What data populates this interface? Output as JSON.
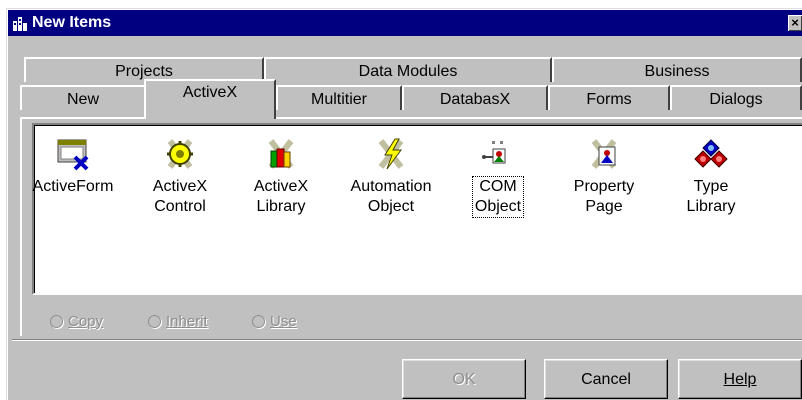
{
  "window": {
    "title": "New Items",
    "close_glyph": "×"
  },
  "tabs_row1": [
    "Projects",
    "Data Modules",
    "Business"
  ],
  "tabs_row2": [
    "New",
    "ActiveX",
    "Multitier",
    "DatabasX",
    "Forms",
    "Dialogs"
  ],
  "active_tab": "ActiveX",
  "items": [
    {
      "label": "ActiveForm",
      "icon": "activeform-icon"
    },
    {
      "label": "ActiveX\nControl",
      "icon": "activex-control-icon"
    },
    {
      "label": "ActiveX\nLibrary",
      "icon": "activex-library-icon"
    },
    {
      "label": "Automation\nObject",
      "icon": "automation-object-icon"
    },
    {
      "label": "COM\nObject",
      "icon": "com-object-icon",
      "focused": true
    },
    {
      "label": "Property\nPage",
      "icon": "property-page-icon"
    },
    {
      "label": "Type\nLibrary",
      "icon": "type-library-icon"
    }
  ],
  "options": [
    {
      "label": "Copy",
      "accel": "C"
    },
    {
      "label": "Inherit",
      "accel": "I"
    },
    {
      "label": "Use",
      "accel": "U"
    }
  ],
  "buttons": {
    "ok": "OK",
    "cancel": "Cancel",
    "help": "Help"
  },
  "colors": {
    "titlebar": "#000080",
    "face": "#c0c0c0",
    "disabled_text": "#8e8e8e"
  }
}
